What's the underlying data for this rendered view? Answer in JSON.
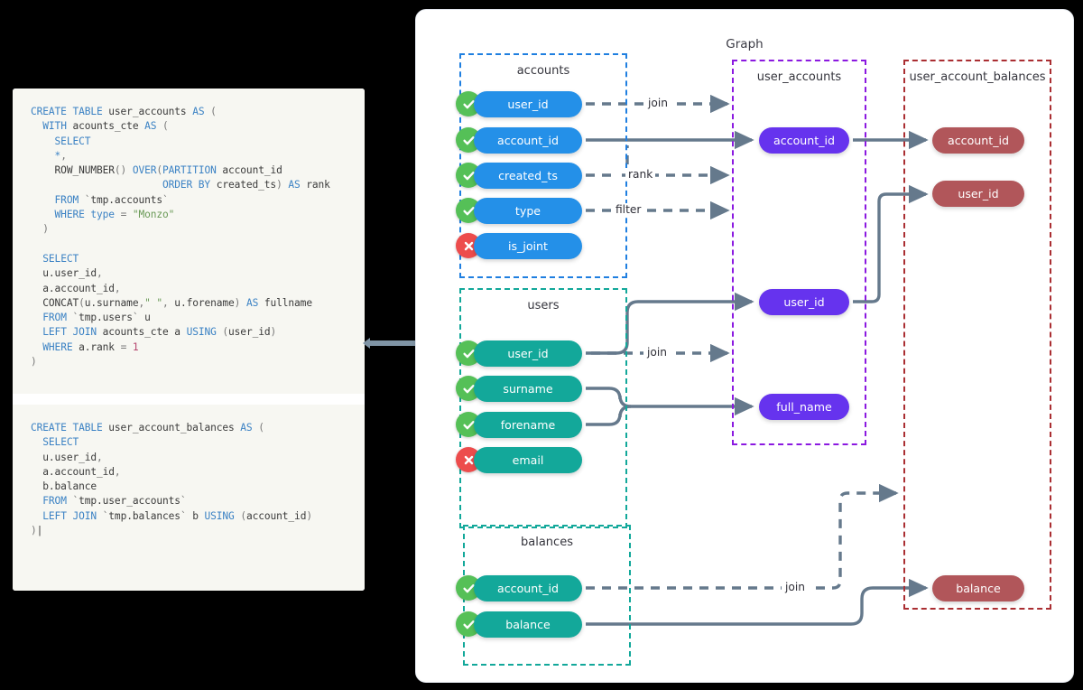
{
  "code_panel": {
    "blocks": [
      {
        "id": "user_accounts_ddl",
        "lines": [
          "CREATE TABLE user_accounts AS (",
          "  WITH acounts_cte AS (",
          "    SELECT",
          "    *,",
          "    ROW_NUMBER() OVER(PARTITION account_id",
          "                      ORDER BY created_ts) AS rank",
          "    FROM `tmp.accounts`",
          "    WHERE type = \"Monzo\"",
          "  )",
          "",
          "  SELECT",
          "  u.user_id,",
          "  a.account_id,",
          "  CONCAT(u.surname,\" \", u.forename) AS fullname",
          "  FROM `tmp.users` u",
          "  LEFT JOIN acounts_cte a USING (user_id)",
          "  WHERE a.rank = 1",
          ")"
        ]
      },
      {
        "id": "user_account_balances_ddl",
        "lines": [
          "CREATE TABLE user_account_balances AS (",
          "  SELECT",
          "  u.user_id,",
          "  a.account_id,",
          "  b.balance",
          "  FROM `tmp.user_accounts`",
          "  LEFT JOIN `tmp.balances` b USING (account_id)",
          ")"
        ]
      }
    ]
  },
  "graph": {
    "title": "Graph",
    "colors": {
      "accounts_border": "#1f7fe0",
      "users_border": "#12a89a",
      "balances_border": "#12a89a",
      "user_accounts_border": "#8b19e0",
      "user_account_balances_border": "#aa2e32",
      "accounts_pill": "#2490e8",
      "users_pill": "#13a89a",
      "balances_pill": "#13a89a",
      "user_accounts_pill": "#6633ee",
      "user_account_balances_pill": "#b1565a",
      "ok_badge": "#55c057",
      "no_badge": "#ed4c4c",
      "edge": "#65798c"
    },
    "source_tables": [
      {
        "name": "accounts",
        "columns": [
          {
            "label": "user_id",
            "status": "used"
          },
          {
            "label": "account_id",
            "status": "used"
          },
          {
            "label": "created_ts",
            "status": "used"
          },
          {
            "label": "type",
            "status": "used"
          },
          {
            "label": "is_joint",
            "status": "unused"
          }
        ]
      },
      {
        "name": "users",
        "columns": [
          {
            "label": "user_id",
            "status": "used"
          },
          {
            "label": "surname",
            "status": "used"
          },
          {
            "label": "forename",
            "status": "used"
          },
          {
            "label": "email",
            "status": "unused"
          }
        ]
      },
      {
        "name": "balances",
        "columns": [
          {
            "label": "account_id",
            "status": "used"
          },
          {
            "label": "balance",
            "status": "used"
          }
        ]
      }
    ],
    "derived_tables": [
      {
        "name": "user_accounts",
        "columns": [
          {
            "label": "account_id"
          },
          {
            "label": "user_id"
          },
          {
            "label": "full_name"
          }
        ]
      },
      {
        "name": "user_account_balances",
        "columns": [
          {
            "label": "account_id"
          },
          {
            "label": "user_id"
          },
          {
            "label": "balance"
          }
        ]
      }
    ],
    "edge_labels": [
      {
        "id": "accounts-user-id-join",
        "text": "join"
      },
      {
        "id": "accounts-created-ts-rank",
        "text": "rank"
      },
      {
        "id": "accounts-type-filter",
        "text": "filter"
      },
      {
        "id": "users-user-id-join",
        "text": "join"
      },
      {
        "id": "balances-account-id-join",
        "text": "join"
      }
    ]
  }
}
